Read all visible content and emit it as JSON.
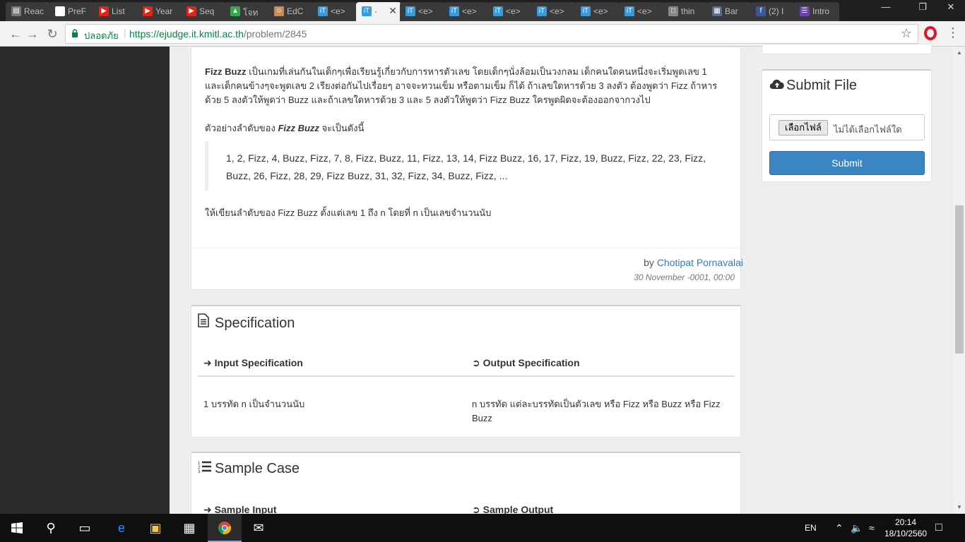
{
  "browser": {
    "tabs": [
      {
        "label": "Reac",
        "icon": "page-icon"
      },
      {
        "label": "PreF",
        "icon": "github-icon"
      },
      {
        "label": "List",
        "icon": "youtube-icon"
      },
      {
        "label": "Year",
        "icon": "youtube-icon"
      },
      {
        "label": "Seq",
        "icon": "youtube-icon"
      },
      {
        "label": "โจท",
        "icon": "drive-icon"
      },
      {
        "label": "EdC",
        "icon": "avatar-icon"
      },
      {
        "label": "<e>",
        "icon": "it-icon"
      },
      {
        "label": "·",
        "icon": "it-icon",
        "active": true
      },
      {
        "label": "<e>",
        "icon": "it-icon"
      },
      {
        "label": "<e>",
        "icon": "it-icon"
      },
      {
        "label": "<e>",
        "icon": "it-icon"
      },
      {
        "label": "<e>",
        "icon": "it-icon"
      },
      {
        "label": "<e>",
        "icon": "it-icon"
      },
      {
        "label": "<e>",
        "icon": "it-icon"
      },
      {
        "label": "thin",
        "icon": "doc-icon"
      },
      {
        "label": "Bar",
        "icon": "grid-icon"
      },
      {
        "label": "(2) I",
        "icon": "facebook-icon"
      },
      {
        "label": "Intro",
        "icon": "list-icon"
      }
    ],
    "secure_label": "ปลอดภัย",
    "url_host": "https://ejudge.it.kmitl.ac.th",
    "url_path": "/problem/2845"
  },
  "problem": {
    "para1_bold": "Fizz Buzz",
    "para1_line1": " เป็นเกมที่เล่นกันในเด็กๆเพื่อเรียนรู้เกี่ยวกับการหารตัวเลข โดยเด็กๆนั่งล้อมเป็นวงกลม เด็กคนใดคนหนึ่งจะเริ่มพูดเลข 1",
    "para1_line2": "และเด็กคนข้างๆจะพูดเลข 2 เรียงต่อกันไปเรื่อยๆ อาจจะทวนเข็ม หรือตามเข็ม ก็ได้ ถ้าเลขใดหารด้วย 3 ลงตัว ต้องพูดว่า Fizz ถ้าหาร",
    "para1_line3": "ด้วย 5 ลงตัวให้พูดว่า Buzz และถ้าเลขใดหารด้วย 3 และ 5 ลงตัวให้พูดว่า Fizz Buzz ใครพูดผิดจะต้องออกจากวงไป",
    "example_intro": "ตัวอย่างลำดับของ ",
    "example_bold": "Fizz Buzz",
    "example_tail": " จะเป็นดังนี้",
    "sequence_line1": "1, 2, Fizz, 4, Buzz, Fizz, 7, 8, Fizz, Buzz, 11, Fizz, 13, 14, Fizz Buzz, 16, 17, Fizz, 19, Buzz, Fizz, 22, 23, Fizz,",
    "sequence_line2": "Buzz, 26, Fizz, 28, 29, Fizz Buzz, 31, 32, Fizz, 34, Buzz, Fizz, ...",
    "task": "ให้เขียนลำดับของ Fizz Buzz ตั้งแต่เลข 1 ถึง n โดยที่ n เป็นเลขจำนวนนับ",
    "by": "by ",
    "author": "Chotipat Pornavalai",
    "date": "30 November -0001, 00:00"
  },
  "specification": {
    "title": "Specification",
    "input_head": "Input Specification",
    "output_head": "Output Specification",
    "input_text": "1 บรรทัด n เป็นจำนวนนับ",
    "output_line1": "n บรรทัด แต่ละบรรทัดเป็นตัวเลข หรือ Fizz หรือ Buzz หรือ Fizz",
    "output_line2": "Buzz"
  },
  "sample": {
    "title": "Sample Case",
    "input_head": "Sample Input",
    "output_head": "Sample Output"
  },
  "submit": {
    "title": "Submit File",
    "choose_label": "เลือกไฟล์",
    "no_file": "ไม่ได้เลือกไฟล์ใด",
    "button": "Submit"
  },
  "taskbar": {
    "lang": "EN",
    "time": "20:14",
    "date": "18/10/2560"
  }
}
